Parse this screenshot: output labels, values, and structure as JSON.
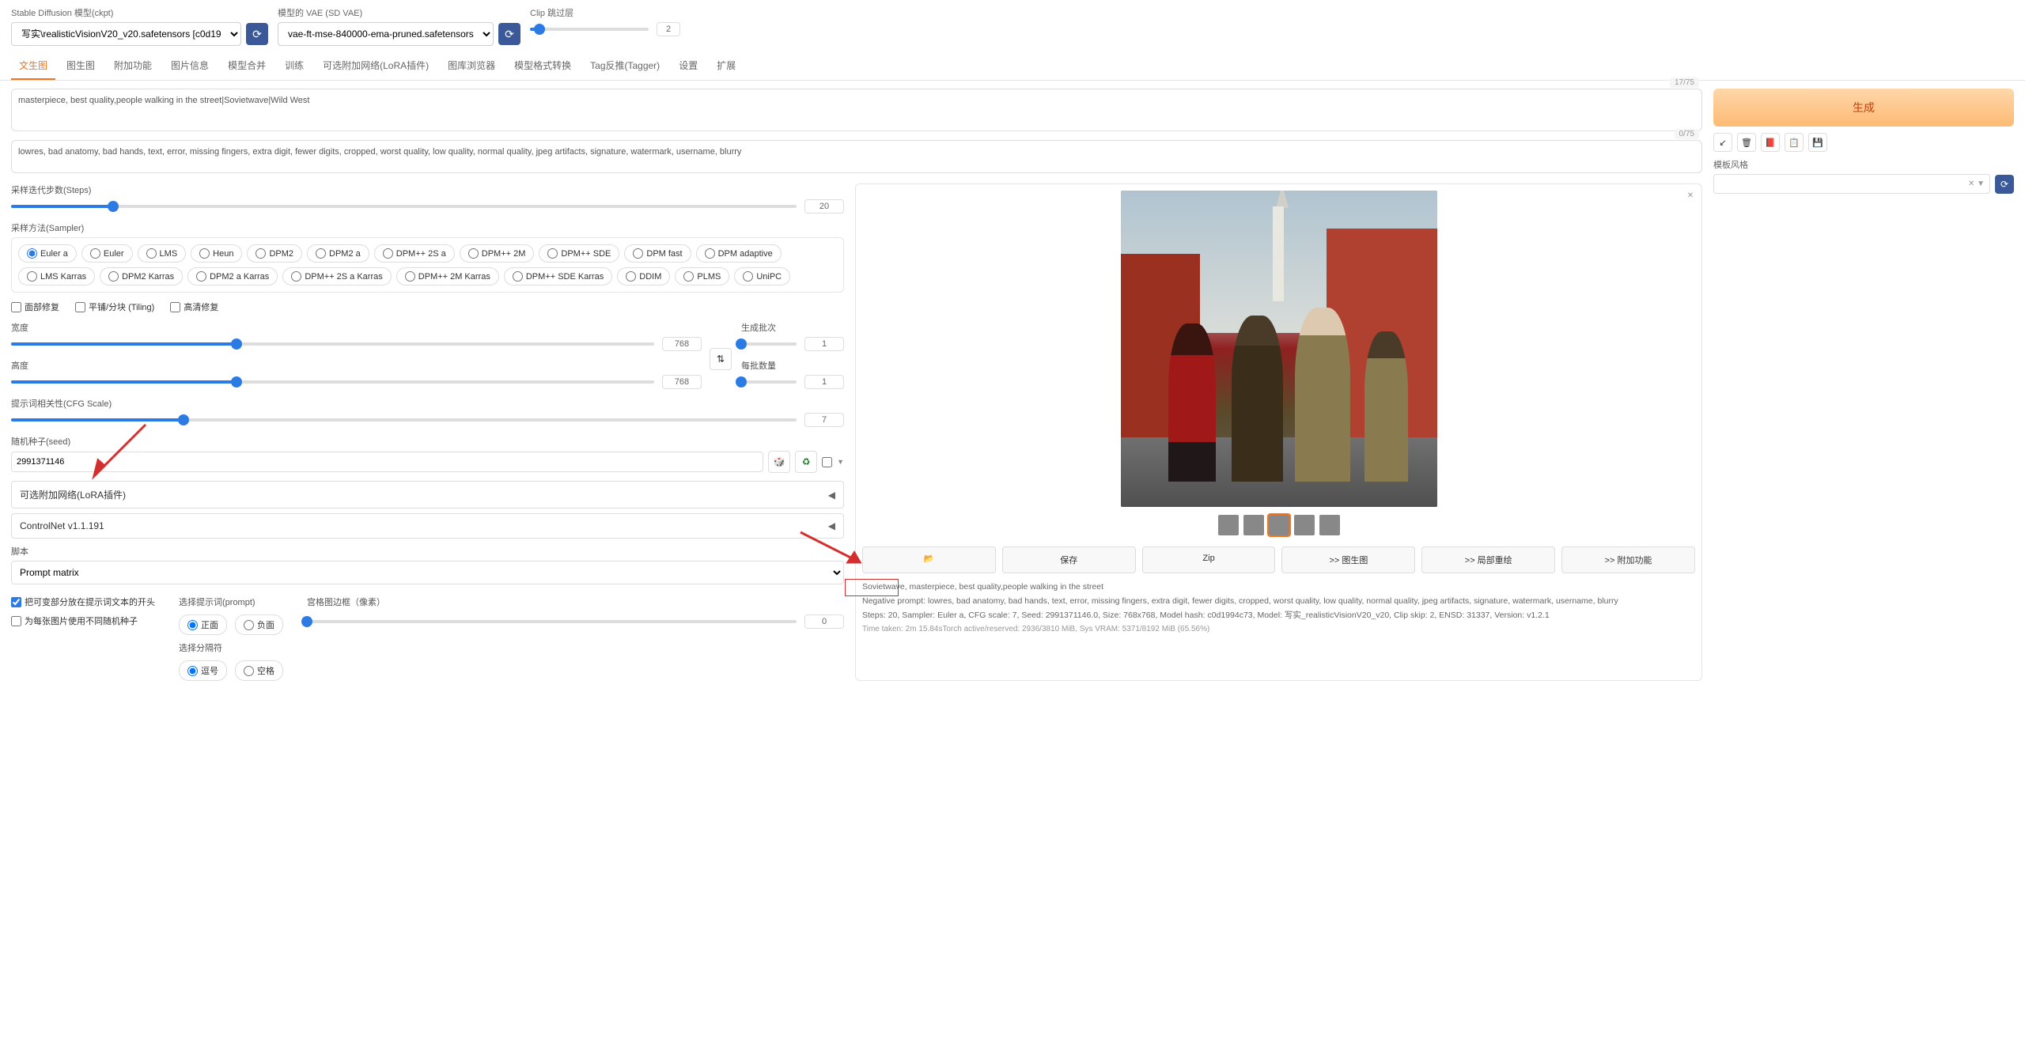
{
  "top": {
    "model_label": "Stable Diffusion 模型(ckpt)",
    "model_value": "写实\\realisticVisionV20_v20.safetensors [c0d19",
    "vae_label": "模型的 VAE (SD VAE)",
    "vae_value": "vae-ft-mse-840000-ema-pruned.safetensors",
    "clip_label": "Clip 跳过层",
    "clip_value": "2"
  },
  "tabs": [
    "文生图",
    "图生图",
    "附加功能",
    "图片信息",
    "模型合并",
    "训练",
    "可选附加网络(LoRA插件)",
    "图库浏览器",
    "模型格式转换",
    "Tag反推(Tagger)",
    "设置",
    "扩展"
  ],
  "active_tab": 0,
  "prompt": {
    "positive": "masterpiece, best quality,people walking in the street|Sovietwave|Wild West",
    "pos_tokens": "17/75",
    "negative": "lowres, bad anatomy, bad hands, text, error, missing fingers, extra digit, fewer digits, cropped, worst quality, low quality, normal quality, jpeg artifacts, signature, watermark, username, blurry",
    "neg_tokens": "0/75"
  },
  "generate": "生成",
  "style_label": "模板风格",
  "steps": {
    "label": "采样迭代步数(Steps)",
    "value": "20"
  },
  "sampler": {
    "label": "采样方法(Sampler)",
    "options": [
      "Euler a",
      "Euler",
      "LMS",
      "Heun",
      "DPM2",
      "DPM2 a",
      "DPM++ 2S a",
      "DPM++ 2M",
      "DPM++ SDE",
      "DPM fast",
      "DPM adaptive",
      "LMS Karras",
      "DPM2 Karras",
      "DPM2 a Karras",
      "DPM++ 2S a Karras",
      "DPM++ 2M Karras",
      "DPM++ SDE Karras",
      "DDIM",
      "PLMS",
      "UniPC"
    ],
    "selected": "Euler a"
  },
  "restore": {
    "face": "面部修复",
    "tiling": "平铺/分块 (Tiling)",
    "hires": "高清修复"
  },
  "width": {
    "label": "宽度",
    "value": "768"
  },
  "height": {
    "label": "高度",
    "value": "768"
  },
  "batch_count": {
    "label": "生成批次",
    "value": "1"
  },
  "batch_size": {
    "label": "每批数量",
    "value": "1"
  },
  "cfg": {
    "label": "提示词相关性(CFG Scale)",
    "value": "7"
  },
  "seed": {
    "label": "随机种子(seed)",
    "value": "2991371146"
  },
  "lora": "可选附加网络(LoRA插件)",
  "controlnet": "ControlNet v1.1.191",
  "script": {
    "label": "脚本",
    "value": "Prompt matrix"
  },
  "matrix": {
    "put_start": "把可变部分放在提示词文本的开头",
    "diff_seed": "为每张图片使用不同随机种子",
    "select_prompt": "选择提示词(prompt)",
    "positive": "正面",
    "negative": "负面",
    "select_sep": "选择分隔符",
    "comma": "逗号",
    "space": "空格",
    "margin": "宫格图边框（像素）",
    "margin_val": "0"
  },
  "output_buttons": {
    "folder": "📂",
    "save": "保存",
    "zip": "Zip",
    "img2img": ">> 图生图",
    "inpaint": ">> 局部重绘",
    "extras": ">> 附加功能"
  },
  "info": {
    "line1": "Sovietwave, masterpiece, best quality,people walking in the street",
    "line2": "Negative prompt: lowres, bad anatomy, bad hands, text, error, missing fingers, extra digit, fewer digits, cropped, worst quality, low quality, normal quality, jpeg artifacts, signature, watermark, username, blurry",
    "line3": "Steps: 20, Sampler: Euler a, CFG scale: 7, Seed: 2991371146.0, Size: 768x768, Model hash: c0d1994c73, Model: 写实_realisticVisionV20_v20, Clip skip: 2, ENSD: 31337, Version: v1.2.1",
    "line4": "Time taken: 2m 15.84sTorch active/reserved: 2936/3810 MiB, Sys VRAM: 5371/8192 MiB (65.56%)"
  }
}
